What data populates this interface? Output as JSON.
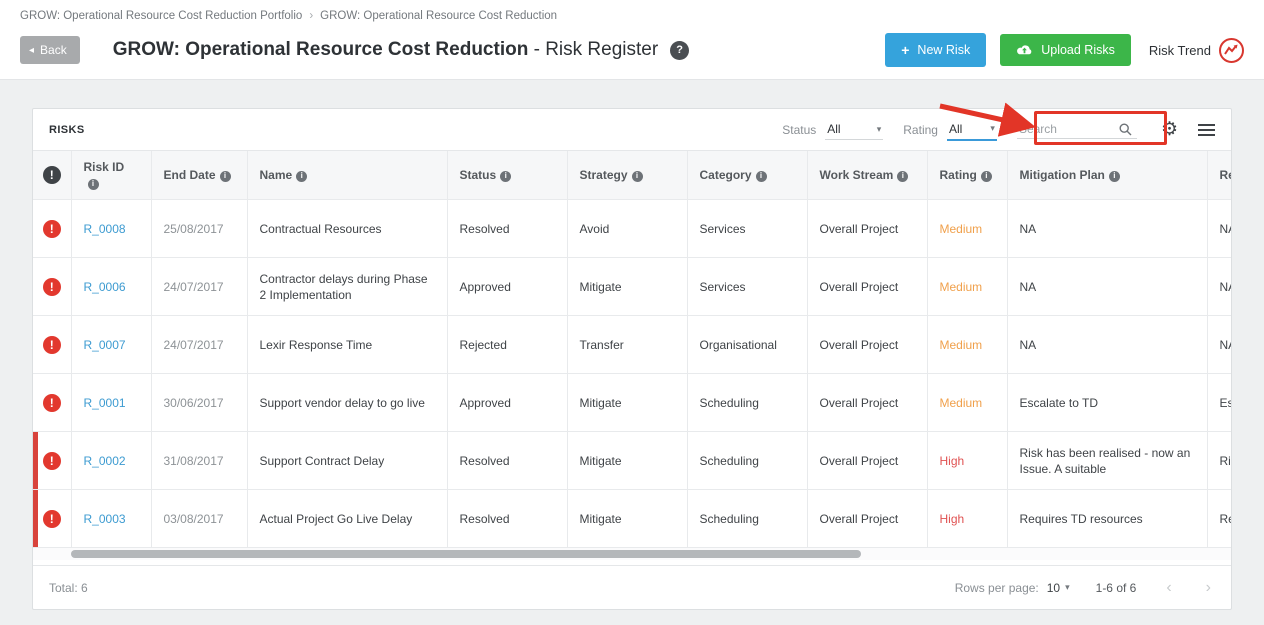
{
  "breadcrumb": {
    "part1": "GROW: Operational Resource Cost Reduction Portfolio",
    "separator": "›",
    "part2": "GROW: Operational Resource Cost Reduction"
  },
  "header": {
    "back_label": "Back",
    "title_main": "GROW: Operational Resource Cost Reduction",
    "title_suffix": " - Risk Register",
    "new_risk_label": "New Risk",
    "upload_risks_label": "Upload Risks",
    "risk_trend_label": "Risk Trend"
  },
  "toolbar": {
    "title": "RISKS",
    "status_label": "Status",
    "status_value": "All",
    "rating_label": "Rating",
    "rating_value": "All",
    "search_placeholder": "Search"
  },
  "icons": {
    "back": "◂",
    "plus": "+",
    "help": "?",
    "alert": "!",
    "info": "i",
    "caret": "▾",
    "gear": "⚙",
    "chev_left": "‹",
    "chev_right": "›"
  },
  "table": {
    "columns": [
      "Risk ID",
      "End Date",
      "Name",
      "Status",
      "Strategy",
      "Category",
      "Work Stream",
      "Rating",
      "Mitigation Plan",
      "Res"
    ],
    "rows": [
      {
        "id": "R_0008",
        "end_date": "25/08/2017",
        "name": "Contractual Resources",
        "status": "Resolved",
        "strategy": "Avoid",
        "category": "Services",
        "work_stream": "Overall Project",
        "rating": "Medium",
        "mitigation": "NA",
        "response": "NA",
        "flagged": false
      },
      {
        "id": "R_0006",
        "end_date": "24/07/2017",
        "name": "Contractor delays during Phase 2 Implementation",
        "status": "Approved",
        "strategy": "Mitigate",
        "category": "Services",
        "work_stream": "Overall Project",
        "rating": "Medium",
        "mitigation": "NA",
        "response": "NA",
        "flagged": false
      },
      {
        "id": "R_0007",
        "end_date": "24/07/2017",
        "name": "Lexir Response Time",
        "status": "Rejected",
        "strategy": "Transfer",
        "category": "Organisational",
        "work_stream": "Overall Project",
        "rating": "Medium",
        "mitigation": "NA",
        "response": "NA",
        "flagged": false
      },
      {
        "id": "R_0001",
        "end_date": "30/06/2017",
        "name": "Support vendor delay to go live",
        "status": "Approved",
        "strategy": "Mitigate",
        "category": "Scheduling",
        "work_stream": "Overall Project",
        "rating": "Medium",
        "mitigation": "Escalate to TD",
        "response": "Esca",
        "flagged": false
      },
      {
        "id": "R_0002",
        "end_date": "31/08/2017",
        "name": "Support Contract Delay",
        "status": "Resolved",
        "strategy": "Mitigate",
        "category": "Scheduling",
        "work_stream": "Overall Project",
        "rating": "High",
        "mitigation": "Risk has been realised - now an Issue. A suitable",
        "response": "Risk Issu",
        "flagged": true
      },
      {
        "id": "R_0003",
        "end_date": "03/08/2017",
        "name": "Actual Project Go Live Delay",
        "status": "Resolved",
        "strategy": "Mitigate",
        "category": "Scheduling",
        "work_stream": "Overall Project",
        "rating": "High",
        "mitigation": "Requires TD resources",
        "response": "Req",
        "flagged": true
      }
    ]
  },
  "footer": {
    "total": "Total: 6",
    "rows_per_page_label": "Rows per page:",
    "rows_per_page_value": "10",
    "range": "1-6 of 6"
  },
  "colors": {
    "accent_blue": "#35a3dc",
    "accent_green": "#3cb649",
    "alert_red": "#e2382e",
    "rating_medium": "#f0a04b",
    "rating_high": "#e05252",
    "link_blue": "#3d9bd1",
    "annotation_red": "#e23527"
  }
}
